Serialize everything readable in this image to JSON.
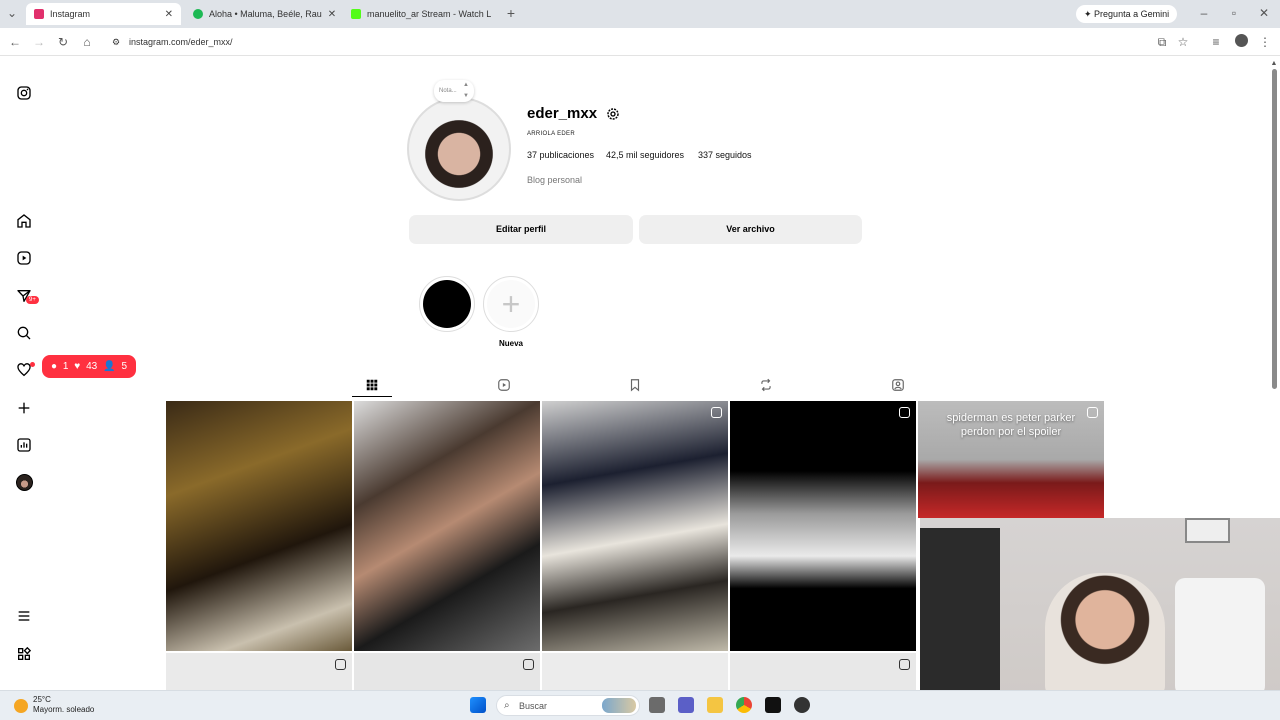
{
  "browser": {
    "tabs": [
      {
        "label": "Instagram",
        "active": true,
        "favicon_color": "#e1306c"
      },
      {
        "label": "Aloha • Maluma, Beéle, Rau",
        "active": false,
        "favicon_color": "#1db954"
      },
      {
        "label": "manuelito_ar Stream - Watch L",
        "active": false,
        "favicon_color": "#53fc18"
      }
    ],
    "url": "instagram.com/eder_mxx/",
    "gemini_label": "Pregunta a Gemini"
  },
  "profile": {
    "note_label": "Nota...",
    "username": "eder_mxx",
    "full_name": "ARRIOLA EDER",
    "posts": "37 publicaciones",
    "followers": "42,5 mil seguidores",
    "following": "337 seguidos",
    "category": "Blog personal",
    "edit_button": "Editar perfil",
    "archive_button": "Ver archivo"
  },
  "highlights": {
    "new_label": "Nueva"
  },
  "sidebar": {
    "messages_badge": "9+",
    "notif_comments": "1",
    "notif_likes": "43",
    "notif_follows": "5"
  },
  "grid": {
    "tile5_caption": "spiderman es peter parker perdon por el spoiler"
  },
  "taskbar": {
    "temperature": "25°C",
    "weather": "Mayorm. soleado",
    "search_placeholder": "Buscar"
  }
}
